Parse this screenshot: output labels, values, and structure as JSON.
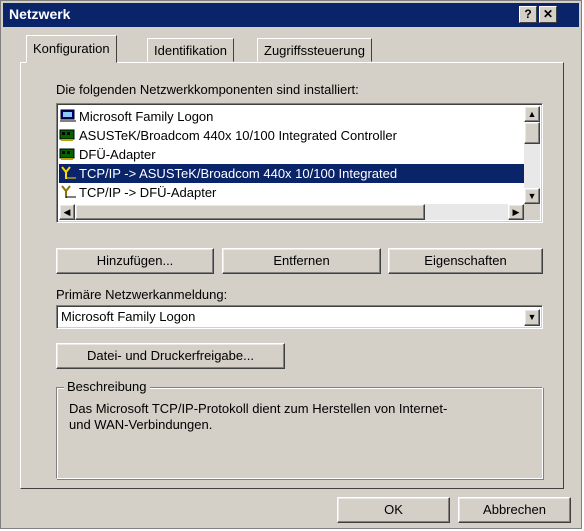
{
  "window": {
    "title": "Netzwerk",
    "help_button": "?",
    "close_button": "✕"
  },
  "tabs": [
    {
      "label": "Konfiguration",
      "active": true
    },
    {
      "label": "Identifikation",
      "active": false
    },
    {
      "label": "Zugriffssteuerung",
      "active": false
    }
  ],
  "components": {
    "heading": "Die folgenden Netzwerkkomponenten sind installiert:",
    "items": [
      {
        "label": "Microsoft Family Logon",
        "icon": "computer-icon",
        "selected": false
      },
      {
        "label": "ASUSTeK/Broadcom 440x 10/100 Integrated Controller",
        "icon": "network-card-icon",
        "selected": false
      },
      {
        "label": "DFÜ-Adapter",
        "icon": "network-card-icon",
        "selected": false
      },
      {
        "label": "TCP/IP -> ASUSTeK/Broadcom 440x 10/100 Integrated",
        "icon": "protocol-icon",
        "selected": true
      },
      {
        "label": "TCP/IP -> DFÜ-Adapter",
        "icon": "protocol-icon",
        "selected": false
      }
    ]
  },
  "buttons": {
    "add": "Hinzufügen...",
    "remove": "Entfernen",
    "properties": "Eigenschaften",
    "file_print_sharing": "Datei- und Druckerfreigabe...",
    "ok": "OK",
    "cancel": "Abbrechen"
  },
  "primary_logon": {
    "label": "Primäre Netzwerkanmeldung:",
    "value": "Microsoft Family Logon"
  },
  "description": {
    "label": "Beschreibung",
    "text": "Das Microsoft TCP/IP-Protokoll dient zum Herstellen von Internet- und WAN-Verbindungen."
  },
  "colors": {
    "title_bar": "#0a246a",
    "face": "#d4d0c8",
    "selection": "#0a246a"
  }
}
